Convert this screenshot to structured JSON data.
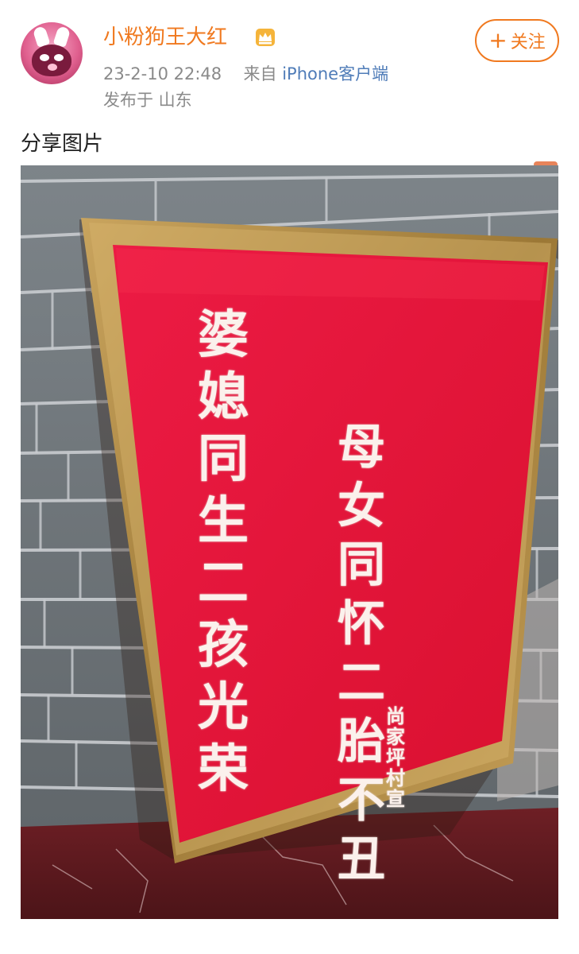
{
  "post": {
    "username": "小粉狗王大红",
    "timestamp": "23-2-10 22:48",
    "source_prefix": "来自",
    "client": "iPhone客户端",
    "location": "发布于 山东",
    "follow_label": "关注",
    "text": "分享图片"
  },
  "photo": {
    "sign_left": [
      "婆",
      "媳",
      "同",
      "生",
      "二",
      "孩",
      "光",
      "荣"
    ],
    "sign_right": [
      "母",
      "女",
      "同",
      "怀",
      "二",
      "胎",
      "不",
      "丑"
    ],
    "sign_small": [
      "尚",
      "家",
      "坪",
      "村",
      "宣"
    ]
  },
  "colors": {
    "username": "#f0791f",
    "follow": "#f0791f",
    "client_link": "#4f7cb8",
    "sign_red": "#e5163d",
    "frame_gold": "#b5904a"
  },
  "icons": {
    "badge": "crown-icon",
    "follow": "plus-icon"
  }
}
